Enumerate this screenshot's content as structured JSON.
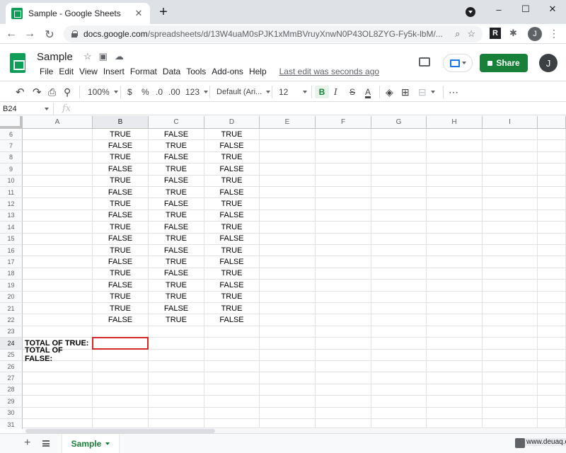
{
  "browser": {
    "tab_title": "Sample - Google Sheets",
    "tab_close": "✕",
    "new_tab": "+",
    "url_host": "docs.google.com",
    "url_path": "/spreadsheets/d/13W4uaM0sPJK1xMmBVruyXnwN0P43OL8ZYG-Fy5k-lbM/...",
    "back": "←",
    "forward": "→",
    "reload": "↻",
    "window_minimize": "–",
    "window_maximize": "☐",
    "window_close": "✕",
    "extension_r": "R",
    "extension_puzzle": "✱",
    "search_glyph": "⌕",
    "star_glyph": "☆",
    "menu_glyph": "⋮",
    "avatar_initial": "J"
  },
  "app": {
    "doc_title": "Sample",
    "menu": [
      "File",
      "Edit",
      "View",
      "Insert",
      "Format",
      "Data",
      "Tools",
      "Add-ons",
      "Help"
    ],
    "last_edit": "Last edit was seconds ago",
    "share_label": "Share",
    "avatar_initial": "J",
    "star_glyph": "☆",
    "folder_glyph": "▣",
    "cloud_glyph": "☁"
  },
  "toolbar": {
    "undo": "↶",
    "redo": "↷",
    "print": "⎙",
    "paint": "⚲",
    "zoom": "100%",
    "currency": "$",
    "percent": "%",
    "dec_decrease": ".0",
    "dec_increase": ".00",
    "number_format": "123",
    "font": "Default (Ari...",
    "font_size": "12",
    "bold": "B",
    "italic": "I",
    "strike": "S",
    "text_color": "A",
    "fill": "◈",
    "borders": "⊞",
    "merge": "⊟",
    "more": "⋯"
  },
  "formula_bar": {
    "name_box": "B24",
    "fx": "fx",
    "value": ""
  },
  "grid": {
    "columns": [
      "A",
      "B",
      "C",
      "D",
      "E",
      "F",
      "G",
      "H",
      "I"
    ],
    "selected_column": "B",
    "selected_row": "24",
    "selected_cell": "B24",
    "rows": [
      {
        "n": "6",
        "A": "",
        "B": "TRUE",
        "C": "FALSE",
        "D": "TRUE"
      },
      {
        "n": "7",
        "A": "",
        "B": "FALSE",
        "C": "TRUE",
        "D": "FALSE"
      },
      {
        "n": "8",
        "A": "",
        "B": "TRUE",
        "C": "FALSE",
        "D": "TRUE"
      },
      {
        "n": "9",
        "A": "",
        "B": "FALSE",
        "C": "TRUE",
        "D": "FALSE"
      },
      {
        "n": "10",
        "A": "",
        "B": "TRUE",
        "C": "FALSE",
        "D": "TRUE"
      },
      {
        "n": "11",
        "A": "",
        "B": "FALSE",
        "C": "TRUE",
        "D": "FALSE"
      },
      {
        "n": "12",
        "A": "",
        "B": "TRUE",
        "C": "FALSE",
        "D": "TRUE"
      },
      {
        "n": "13",
        "A": "",
        "B": "FALSE",
        "C": "TRUE",
        "D": "FALSE"
      },
      {
        "n": "14",
        "A": "",
        "B": "TRUE",
        "C": "FALSE",
        "D": "TRUE"
      },
      {
        "n": "15",
        "A": "",
        "B": "FALSE",
        "C": "TRUE",
        "D": "FALSE"
      },
      {
        "n": "16",
        "A": "",
        "B": "TRUE",
        "C": "FALSE",
        "D": "TRUE"
      },
      {
        "n": "17",
        "A": "",
        "B": "FALSE",
        "C": "TRUE",
        "D": "FALSE"
      },
      {
        "n": "18",
        "A": "",
        "B": "TRUE",
        "C": "FALSE",
        "D": "TRUE"
      },
      {
        "n": "19",
        "A": "",
        "B": "FALSE",
        "C": "TRUE",
        "D": "FALSE"
      },
      {
        "n": "20",
        "A": "",
        "B": "TRUE",
        "C": "TRUE",
        "D": "TRUE"
      },
      {
        "n": "21",
        "A": "",
        "B": "TRUE",
        "C": "FALSE",
        "D": "TRUE"
      },
      {
        "n": "22",
        "A": "",
        "B": "FALSE",
        "C": "TRUE",
        "D": "FALSE"
      },
      {
        "n": "23",
        "A": "",
        "B": "",
        "C": "",
        "D": ""
      },
      {
        "n": "24",
        "A": "TOTAL OF TRUE:",
        "B": "",
        "C": "",
        "D": ""
      },
      {
        "n": "25",
        "A": "TOTAL OF FALSE:",
        "B": "",
        "C": "",
        "D": ""
      },
      {
        "n": "26",
        "A": "",
        "B": "",
        "C": "",
        "D": ""
      },
      {
        "n": "27",
        "A": "",
        "B": "",
        "C": "",
        "D": ""
      },
      {
        "n": "28",
        "A": "",
        "B": "",
        "C": "",
        "D": ""
      },
      {
        "n": "29",
        "A": "",
        "B": "",
        "C": "",
        "D": ""
      },
      {
        "n": "30",
        "A": "",
        "B": "",
        "C": "",
        "D": ""
      },
      {
        "n": "31",
        "A": "",
        "B": "",
        "C": "",
        "D": ""
      }
    ]
  },
  "sheet_bar": {
    "add": "+",
    "active_sheet": "Sample"
  },
  "watermark": "www.deuaq.com",
  "colors": {
    "brand_green": "#188038",
    "selection_red": "#d62828"
  }
}
